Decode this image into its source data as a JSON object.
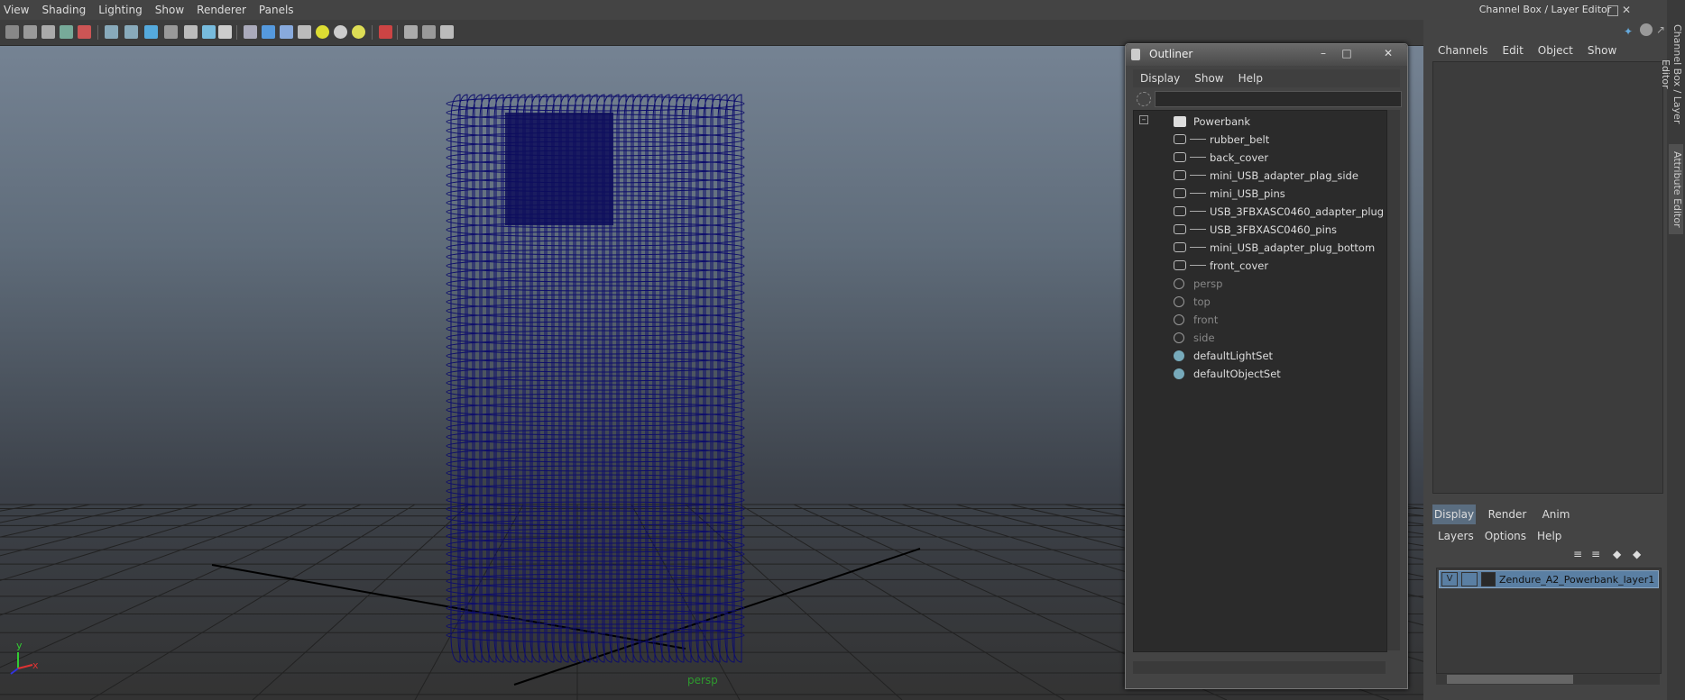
{
  "viewport": {
    "menu": [
      "View",
      "Shading",
      "Lighting",
      "Show",
      "Renderer",
      "Panels"
    ],
    "camera_label": "persp",
    "axis": {
      "y": "y",
      "x": "x",
      "z": "z"
    },
    "colors": {
      "wireframe": "#0d0d6b",
      "grid": "#1a1a1a"
    }
  },
  "outliner": {
    "title": "Outliner",
    "window_buttons": [
      "minimize-icon",
      "maximize-icon",
      "close-icon"
    ],
    "menu": [
      "Display",
      "Show",
      "Help"
    ],
    "items": [
      {
        "label": "Powerbank",
        "type": "group",
        "dim": false
      },
      {
        "label": "rubber_belt",
        "type": "mesh",
        "dim": false
      },
      {
        "label": "back_cover",
        "type": "mesh",
        "dim": false
      },
      {
        "label": "mini_USB_adapter_plag_side",
        "type": "mesh",
        "dim": false
      },
      {
        "label": "mini_USB_pins",
        "type": "mesh",
        "dim": false
      },
      {
        "label": "USB_3FBXASC0460_adapter_plug",
        "type": "mesh",
        "dim": false
      },
      {
        "label": "USB_3FBXASC0460_pins",
        "type": "mesh",
        "dim": false
      },
      {
        "label": "mini_USB_adapter_plug_bottom",
        "type": "mesh",
        "dim": false
      },
      {
        "label": "front_cover",
        "type": "mesh",
        "dim": false
      },
      {
        "label": "persp",
        "type": "camera",
        "dim": true
      },
      {
        "label": "top",
        "type": "camera",
        "dim": true
      },
      {
        "label": "front",
        "type": "camera",
        "dim": true
      },
      {
        "label": "side",
        "type": "camera",
        "dim": true
      },
      {
        "label": "defaultLightSet",
        "type": "set",
        "dim": false
      },
      {
        "label": "defaultObjectSet",
        "type": "set",
        "dim": false
      }
    ]
  },
  "channel_box": {
    "title": "Channel Box / Layer Editor",
    "menu": [
      "Channels",
      "Edit",
      "Object",
      "Show"
    ]
  },
  "layer_editor": {
    "tabs": [
      "Display",
      "Render",
      "Anim"
    ],
    "active_tab": "Display",
    "menu": [
      "Layers",
      "Options",
      "Help"
    ],
    "layer": {
      "visibility": "V",
      "name": "Zendure_A2_Powerbank_layer1"
    }
  },
  "side_tabs": [
    "Channel Box / Layer Editor",
    "Attribute Editor"
  ]
}
